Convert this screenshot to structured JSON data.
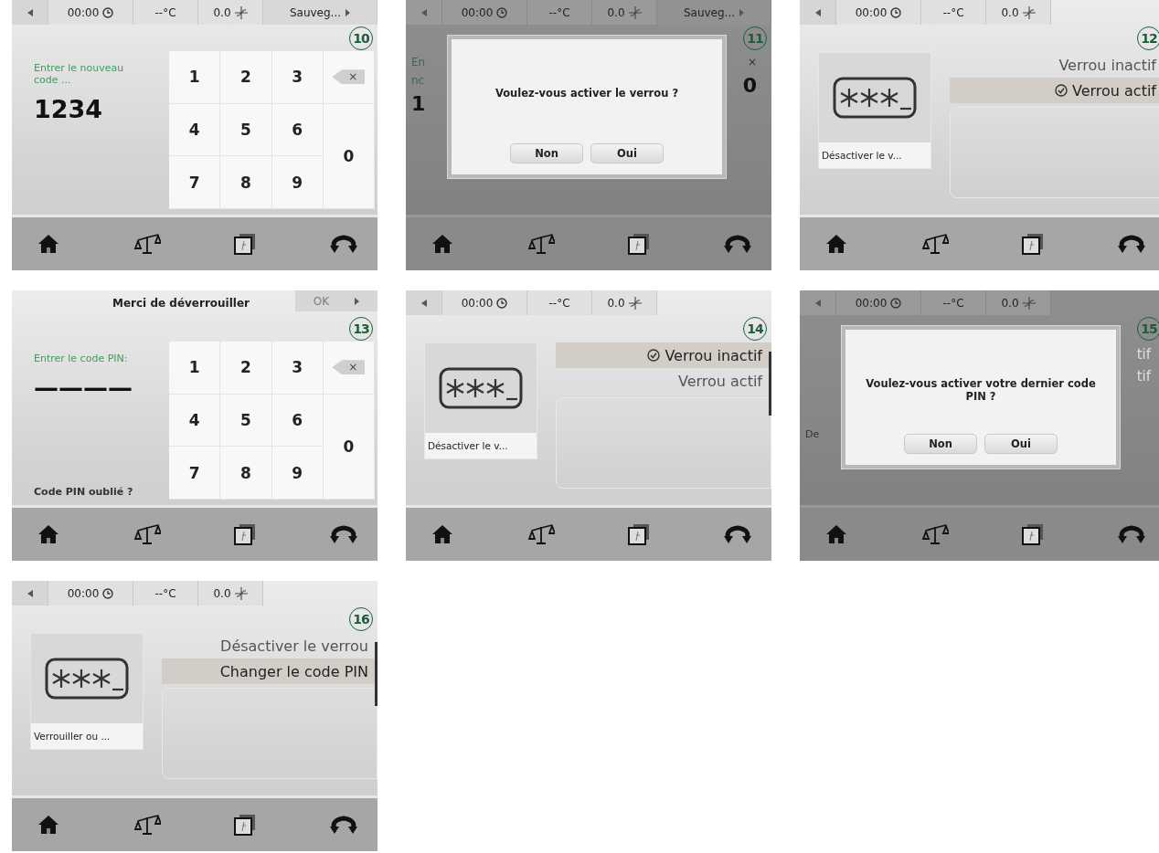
{
  "screens": [
    {
      "badge": "10",
      "kind": "keypad",
      "top_bar": {
        "kind": "status",
        "time": "00:00",
        "temperature": "--°C",
        "fan": "0.0",
        "action": "Sauveg..."
      },
      "prompt": "Entrer le nouveau code ...",
      "value": "1234",
      "keys": [
        "1",
        "2",
        "3",
        "4",
        "5",
        "6",
        "7",
        "8",
        "9"
      ],
      "backspace_key": "×",
      "zero_key": "0"
    },
    {
      "badge": "11",
      "kind": "dialog",
      "top_bar": {
        "kind": "status",
        "time": "00:00",
        "temperature": "--°C",
        "fan": "0.0",
        "action": "Sauveg..."
      },
      "left_fragments": [
        {
          "kind": "prompt",
          "text": "En"
        },
        {
          "kind": "prompt",
          "text": "nc"
        },
        {
          "kind": "value",
          "text": "1"
        }
      ],
      "right_fragments": [
        {
          "kind": "key",
          "text": "×"
        },
        {
          "kind": "value",
          "text": "0"
        }
      ],
      "message": "Voulez-vous activer le verrou ?",
      "buttons": [
        "Non",
        "Oui"
      ]
    },
    {
      "badge": "12",
      "kind": "menu",
      "top_bar": {
        "kind": "status",
        "time": "00:00",
        "temperature": "--°C",
        "fan": "0.0"
      },
      "tile_label": "Désactiver le v...",
      "options": [
        {
          "label": "Verrou inactif",
          "selected": false,
          "checked": false
        },
        {
          "label": "Verrou actif",
          "selected": true,
          "checked": true
        }
      ],
      "scrollbar": false
    },
    {
      "badge": "13",
      "kind": "keypad",
      "top_bar": {
        "kind": "title",
        "title": "Merci de déverrouiller",
        "ok_button": {
          "label": "OK",
          "disabled": true
        }
      },
      "prompt": "Entrer le code PIN:",
      "value": "————",
      "forgot_link": "Code PIN oublié ?",
      "keys": [
        "1",
        "2",
        "3",
        "4",
        "5",
        "6",
        "7",
        "8",
        "9"
      ],
      "backspace_key": "×",
      "zero_key": "0"
    },
    {
      "badge": "14",
      "kind": "menu",
      "top_bar": {
        "kind": "status",
        "time": "00:00",
        "temperature": "--°C",
        "fan": "0.0"
      },
      "tile_label": "Désactiver le v...",
      "options": [
        {
          "label": "Verrou inactif",
          "selected": true,
          "checked": true
        },
        {
          "label": "Verrou actif",
          "selected": false,
          "checked": false
        }
      ],
      "scrollbar": true
    },
    {
      "badge": "15",
      "kind": "dialog",
      "top_bar": {
        "kind": "status",
        "time": "00:00",
        "temperature": "--°C",
        "fan": "0.0"
      },
      "left_fragments": [
        {
          "kind": "label",
          "text": "De"
        }
      ],
      "right_fragments": [
        {
          "kind": "option",
          "text": "tif"
        },
        {
          "kind": "option",
          "text": "tif"
        }
      ],
      "message": "Voulez-vous activer votre dernier code PIN ?",
      "buttons": [
        "Non",
        "Oui"
      ]
    },
    {
      "badge": "16",
      "kind": "menu",
      "top_bar": {
        "kind": "status",
        "time": "00:00",
        "temperature": "--°C",
        "fan": "0.0"
      },
      "tile_label": "Verrouiller ou ...",
      "options": [
        {
          "label": "Désactiver le verrou",
          "selected": false,
          "checked": false
        },
        {
          "label": "Changer le code PIN",
          "selected": true,
          "checked": false
        }
      ],
      "scrollbar": true
    }
  ]
}
